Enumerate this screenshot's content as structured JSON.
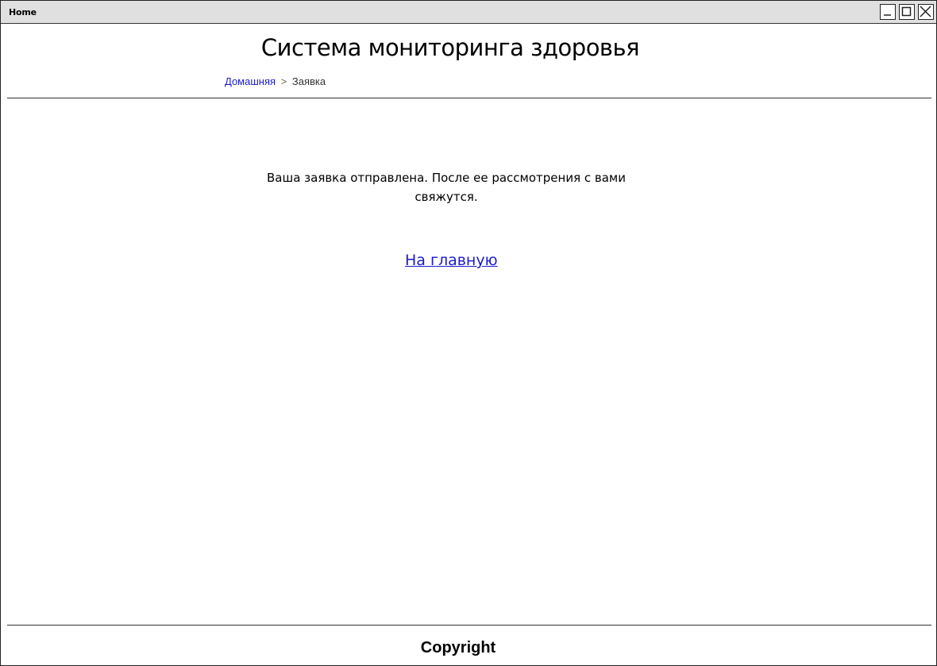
{
  "window": {
    "title": "Home",
    "controls": {
      "minimize_icon": "minimize-icon",
      "maximize_icon": "maximize-icon",
      "close_icon": "close-icon"
    }
  },
  "header": {
    "title": "Система мониторинга здоровья",
    "breadcrumb": {
      "home_label": "Домашняя",
      "separator": ">",
      "current_label": "Заявка"
    }
  },
  "main": {
    "message": "Ваша заявка отправлена. После ее рассмотрения с вами свяжутся.",
    "home_link_label": "На главную"
  },
  "footer": {
    "text": "Copyright"
  },
  "colors": {
    "link": "#1a1ad0",
    "titlebar": "#e0e0e0",
    "border": "#333333"
  }
}
